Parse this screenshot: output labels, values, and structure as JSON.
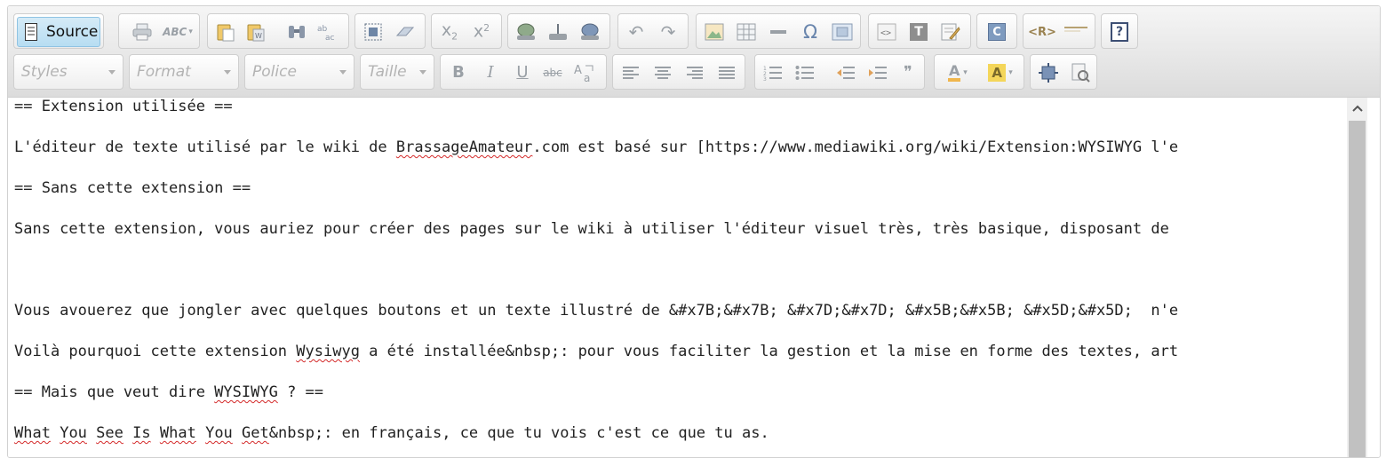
{
  "toolbar": {
    "source_label": "Source",
    "styles_placeholder": "Styles",
    "format_placeholder": "Format",
    "font_placeholder": "Police",
    "size_placeholder": "Taille",
    "spell_glyph": "ABC",
    "help_glyph": "?",
    "omega_glyph": "Ω",
    "subscript_glyph": "x",
    "subscript_sub": "2",
    "superscript_glyph": "x",
    "superscript_sup": "2",
    "bold_glyph": "B",
    "italic_glyph": "I",
    "underline_glyph": "U",
    "strike_glyph": "abc",
    "quote_glyph": "❞",
    "c_glyph": "C",
    "t_glyph": "T",
    "r_glyph": "R"
  },
  "content": {
    "lines": [
      "== Extension utilisée ==",
      "L'éditeur de texte utilisé par le wiki de ",
      "== Sans cette extension ==",
      "Sans cette extension, vous auriez pour créer des pages sur le wiki à utiliser l'éditeur visuel très, très basique, disposant de",
      "Vous avouerez que jongler avec quelques boutons et un texte illustré de &#x7B;&#x7B; &#x7D;&#x7D; &#x5B;&#x5B; &#x5D;&#x5D;  n'e",
      "Voilà pourquoi cette extension ",
      "== Mais que veut dire ",
      "What You See Is What You Get&nbsp;: en français, ce que tu vois c'est ce que tu as."
    ],
    "brassage": "BrassageAmateur",
    "line2_rest": ".com est basé sur [https://www.mediawiki.org/wiki/Extension:WYSIWYG l'e",
    "wysiwyg_word": "Wysiwyg",
    "line6_rest": " a été installée&nbsp;: pour vous faciliter la gestion et la mise en forme des textes, art",
    "wysiwyg_caps": "WYSIWYG",
    "line7_rest": " ? ==",
    "w_what": "What",
    "w_you": "You",
    "w_see": "See",
    "w_is": "Is",
    "w_what2": "What",
    "w_you2": "You",
    "w_get": "Get",
    "line8_rest": "&nbsp;: en français, ce que tu vois c'est ce que tu as."
  },
  "colors": {
    "source_active_bg": "#b7ddf2",
    "icon_gray": "#9aa0a6",
    "spell_underline": "#d42b2b"
  }
}
